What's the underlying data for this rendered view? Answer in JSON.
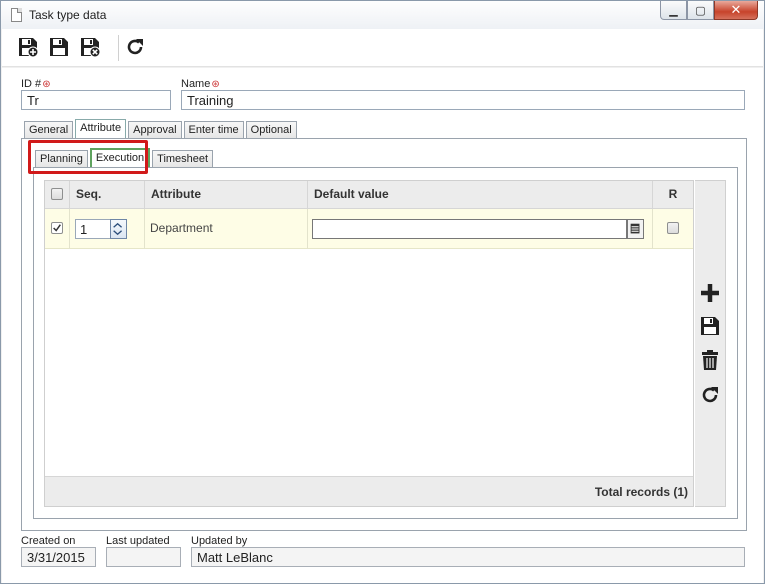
{
  "window": {
    "title": "Task type data",
    "min": "▁",
    "max": "▢",
    "close": "✕"
  },
  "toolbar": {
    "icons": [
      "save-new-icon",
      "save-icon",
      "save-close-icon",
      "refresh-icon"
    ]
  },
  "form": {
    "id_label": "ID #",
    "id_value": "Tr",
    "name_label": "Name",
    "name_value": "Training",
    "required_mark": "⊛"
  },
  "tabs": [
    "General",
    "Attribute",
    "Approval",
    "Enter time",
    "Optional"
  ],
  "subtabs": [
    "Planning",
    "Execution",
    "Timesheet"
  ],
  "grid": {
    "headers": {
      "seq": "Seq.",
      "attribute": "Attribute",
      "default_value": "Default value",
      "r": "R"
    },
    "rows": [
      {
        "checked": true,
        "seq": "1",
        "attribute": "Department",
        "default_value": "",
        "r": false
      }
    ],
    "footer": "Total records (1)"
  },
  "side_actions": [
    "add-icon",
    "save-icon",
    "delete-icon",
    "refresh-icon"
  ],
  "footer": {
    "created_label": "Created on",
    "created_value": "3/31/2015",
    "updated_label": "Last updated",
    "updated_value": "",
    "by_label": "Updated by",
    "by_value": "Matt LeBlanc"
  }
}
